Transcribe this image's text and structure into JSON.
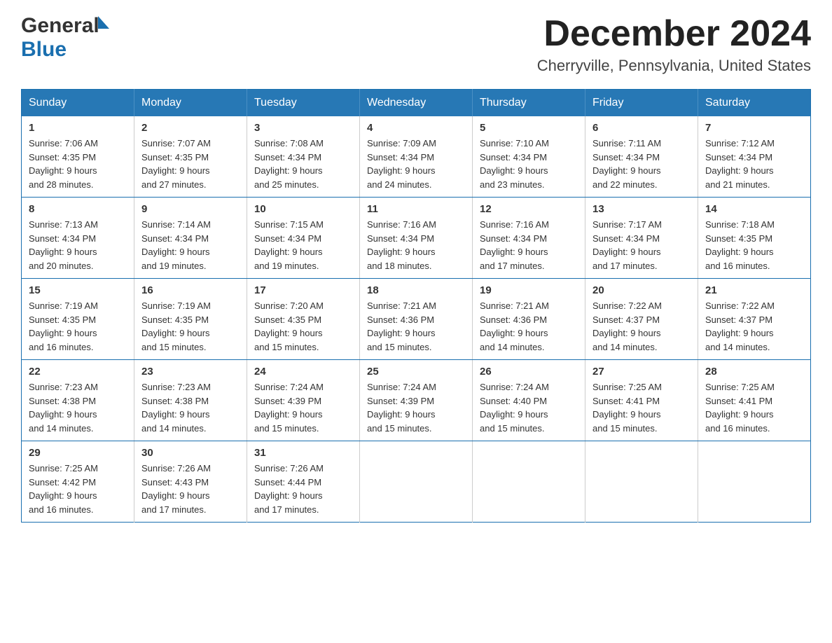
{
  "header": {
    "logo_general": "General",
    "logo_blue": "Blue",
    "month_title": "December 2024",
    "location": "Cherryville, Pennsylvania, United States"
  },
  "weekdays": [
    "Sunday",
    "Monday",
    "Tuesday",
    "Wednesday",
    "Thursday",
    "Friday",
    "Saturday"
  ],
  "weeks": [
    [
      {
        "day": "1",
        "sunrise": "7:06 AM",
        "sunset": "4:35 PM",
        "daylight": "9 hours and 28 minutes."
      },
      {
        "day": "2",
        "sunrise": "7:07 AM",
        "sunset": "4:35 PM",
        "daylight": "9 hours and 27 minutes."
      },
      {
        "day": "3",
        "sunrise": "7:08 AM",
        "sunset": "4:34 PM",
        "daylight": "9 hours and 25 minutes."
      },
      {
        "day": "4",
        "sunrise": "7:09 AM",
        "sunset": "4:34 PM",
        "daylight": "9 hours and 24 minutes."
      },
      {
        "day": "5",
        "sunrise": "7:10 AM",
        "sunset": "4:34 PM",
        "daylight": "9 hours and 23 minutes."
      },
      {
        "day": "6",
        "sunrise": "7:11 AM",
        "sunset": "4:34 PM",
        "daylight": "9 hours and 22 minutes."
      },
      {
        "day": "7",
        "sunrise": "7:12 AM",
        "sunset": "4:34 PM",
        "daylight": "9 hours and 21 minutes."
      }
    ],
    [
      {
        "day": "8",
        "sunrise": "7:13 AM",
        "sunset": "4:34 PM",
        "daylight": "9 hours and 20 minutes."
      },
      {
        "day": "9",
        "sunrise": "7:14 AM",
        "sunset": "4:34 PM",
        "daylight": "9 hours and 19 minutes."
      },
      {
        "day": "10",
        "sunrise": "7:15 AM",
        "sunset": "4:34 PM",
        "daylight": "9 hours and 19 minutes."
      },
      {
        "day": "11",
        "sunrise": "7:16 AM",
        "sunset": "4:34 PM",
        "daylight": "9 hours and 18 minutes."
      },
      {
        "day": "12",
        "sunrise": "7:16 AM",
        "sunset": "4:34 PM",
        "daylight": "9 hours and 17 minutes."
      },
      {
        "day": "13",
        "sunrise": "7:17 AM",
        "sunset": "4:34 PM",
        "daylight": "9 hours and 17 minutes."
      },
      {
        "day": "14",
        "sunrise": "7:18 AM",
        "sunset": "4:35 PM",
        "daylight": "9 hours and 16 minutes."
      }
    ],
    [
      {
        "day": "15",
        "sunrise": "7:19 AM",
        "sunset": "4:35 PM",
        "daylight": "9 hours and 16 minutes."
      },
      {
        "day": "16",
        "sunrise": "7:19 AM",
        "sunset": "4:35 PM",
        "daylight": "9 hours and 15 minutes."
      },
      {
        "day": "17",
        "sunrise": "7:20 AM",
        "sunset": "4:35 PM",
        "daylight": "9 hours and 15 minutes."
      },
      {
        "day": "18",
        "sunrise": "7:21 AM",
        "sunset": "4:36 PM",
        "daylight": "9 hours and 15 minutes."
      },
      {
        "day": "19",
        "sunrise": "7:21 AM",
        "sunset": "4:36 PM",
        "daylight": "9 hours and 14 minutes."
      },
      {
        "day": "20",
        "sunrise": "7:22 AM",
        "sunset": "4:37 PM",
        "daylight": "9 hours and 14 minutes."
      },
      {
        "day": "21",
        "sunrise": "7:22 AM",
        "sunset": "4:37 PM",
        "daylight": "9 hours and 14 minutes."
      }
    ],
    [
      {
        "day": "22",
        "sunrise": "7:23 AM",
        "sunset": "4:38 PM",
        "daylight": "9 hours and 14 minutes."
      },
      {
        "day": "23",
        "sunrise": "7:23 AM",
        "sunset": "4:38 PM",
        "daylight": "9 hours and 14 minutes."
      },
      {
        "day": "24",
        "sunrise": "7:24 AM",
        "sunset": "4:39 PM",
        "daylight": "9 hours and 15 minutes."
      },
      {
        "day": "25",
        "sunrise": "7:24 AM",
        "sunset": "4:39 PM",
        "daylight": "9 hours and 15 minutes."
      },
      {
        "day": "26",
        "sunrise": "7:24 AM",
        "sunset": "4:40 PM",
        "daylight": "9 hours and 15 minutes."
      },
      {
        "day": "27",
        "sunrise": "7:25 AM",
        "sunset": "4:41 PM",
        "daylight": "9 hours and 15 minutes."
      },
      {
        "day": "28",
        "sunrise": "7:25 AM",
        "sunset": "4:41 PM",
        "daylight": "9 hours and 16 minutes."
      }
    ],
    [
      {
        "day": "29",
        "sunrise": "7:25 AM",
        "sunset": "4:42 PM",
        "daylight": "9 hours and 16 minutes."
      },
      {
        "day": "30",
        "sunrise": "7:26 AM",
        "sunset": "4:43 PM",
        "daylight": "9 hours and 17 minutes."
      },
      {
        "day": "31",
        "sunrise": "7:26 AM",
        "sunset": "4:44 PM",
        "daylight": "9 hours and 17 minutes."
      },
      null,
      null,
      null,
      null
    ]
  ],
  "labels": {
    "sunrise": "Sunrise:",
    "sunset": "Sunset:",
    "daylight": "Daylight:"
  }
}
